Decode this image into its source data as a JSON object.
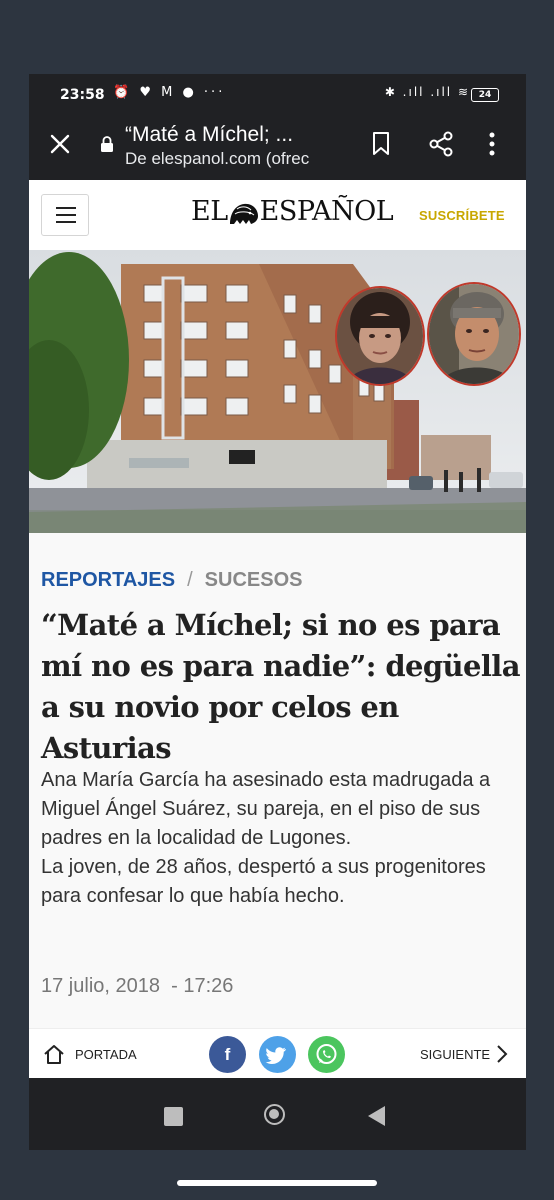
{
  "status_bar": {
    "time": "23:58",
    "left_icons": "⏰ ♥ M ● ···",
    "right_icons": "✱ .ıll .ıll ≋",
    "battery": "24"
  },
  "browser": {
    "page_title": "“Maté a Míchel; ...",
    "origin": "De elespanol.com (ofrec"
  },
  "site": {
    "logo_left": "EL",
    "logo_right": "ESPAÑOL",
    "subscribe_label": "SUSCRÍBETE"
  },
  "article": {
    "section": "REPORTAJES",
    "separator": "/",
    "subsection": "SUCESOS",
    "headline": "“Maté a Míchel; si no es para mí no es para nadie”: degüella a su novio por celos en Asturias",
    "lead_1": "Ana María García ha asesinado esta madrugada a Miguel Ángel Suárez, su pareja, en el piso de sus padres en la localidad de Lugones.",
    "lead_2": "La joven, de 28 años, despertó a sus progenitores para confesar lo que había hecho.",
    "date": "17 julio, 2018",
    "time": "- 17:26"
  },
  "bottom_bar": {
    "home_label": "PORTADA",
    "facebook_glyph": "f",
    "twitter_glyph": "t",
    "next_label": "SIGUIENTE"
  },
  "colors": {
    "section_blue": "#1f57a4",
    "subscribe_gold": "#c8a700",
    "facebook": "#3b5998",
    "twitter": "#4ea1e8",
    "whatsapp": "#4bc55e"
  }
}
